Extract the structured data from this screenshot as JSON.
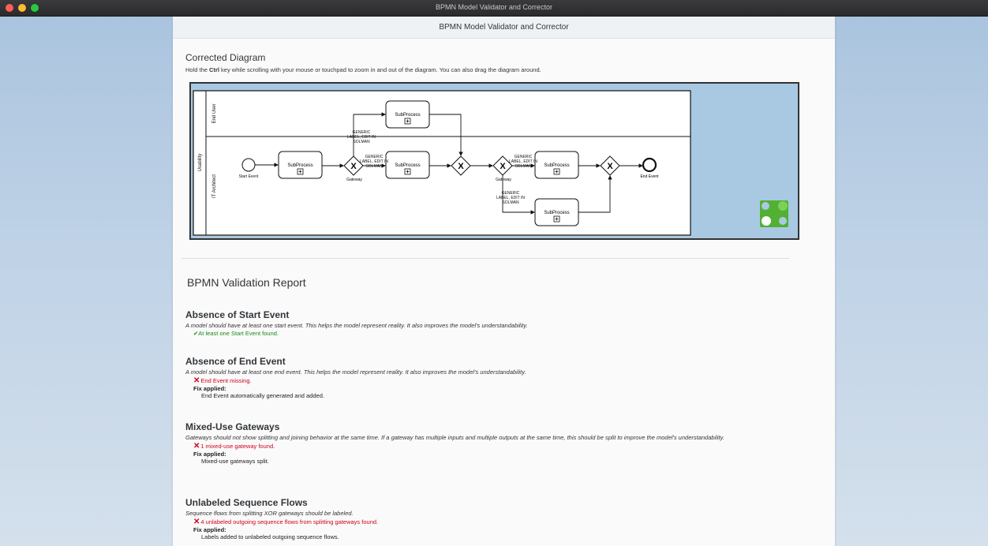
{
  "window": {
    "title": "BPMN Model Validator and Corrector",
    "traffic_lights": [
      "#ff5f57",
      "#febc2e",
      "#28c840"
    ]
  },
  "header": {
    "title": "BPMN Model Validator and Corrector"
  },
  "diagram_section": {
    "title": "Corrected Diagram",
    "hint_prefix": "Hold the ",
    "hint_key": "Ctrl",
    "hint_suffix": " key while scrolling with your mouse or touchpad to zoom in and out of the diagram. You can also drag the diagram around."
  },
  "diagram": {
    "pool_label": "Usability",
    "lanes": [
      "End User",
      "IT Architect"
    ],
    "subprocess_label": "SubProcess",
    "start_event_label": "Start Event",
    "end_event_label": "End Event",
    "gateway_label": "Gateway",
    "flow_label_line1": "GENERIC",
    "flow_label_line2": "LABEL, EDIT IN",
    "flow_label_line3": "SOLMAN"
  },
  "report": {
    "title": "BPMN Validation Report",
    "fix_applied_label": "Fix applied:",
    "checks": [
      {
        "title": "Absence of Start Event",
        "description": "A model should have at least one start event. This helps the model represent reality. It also improves the model's understandability.",
        "result": "✔At least one Start Event found.",
        "status": "ok"
      },
      {
        "title": "Absence of End Event",
        "description": "A model should have at least one end event. This helps the model represent reality. It also improves the model's understandability.",
        "result": "End Event missing.",
        "status": "error",
        "fix": "End Event automatically generated and added."
      },
      {
        "title": "Mixed-Use Gateways",
        "description": "Gateways should not show splitting and joining behavior at the same time. If a gateway has multiple inputs and multiple outputs at the same time, this should be split to improve the model's understandability.",
        "result": "1 mixed-use gateway found.",
        "status": "error",
        "fix": "Mixed-use gateways split."
      },
      {
        "title": "Unlabeled Sequence Flows",
        "description": "Sequence flows from splitting XOR gateways should be labeled.",
        "result": "4 unlabeled outgoing sequence flows from splitting gateways found.",
        "status": "error",
        "fix": "Labels added to unlabeled outgoing sequence flows."
      }
    ]
  },
  "colors": {
    "ok": "#1a8a1a",
    "error": "#d0021b",
    "diagram_background": "#a9c9e3",
    "logo_green": "#52b033"
  }
}
